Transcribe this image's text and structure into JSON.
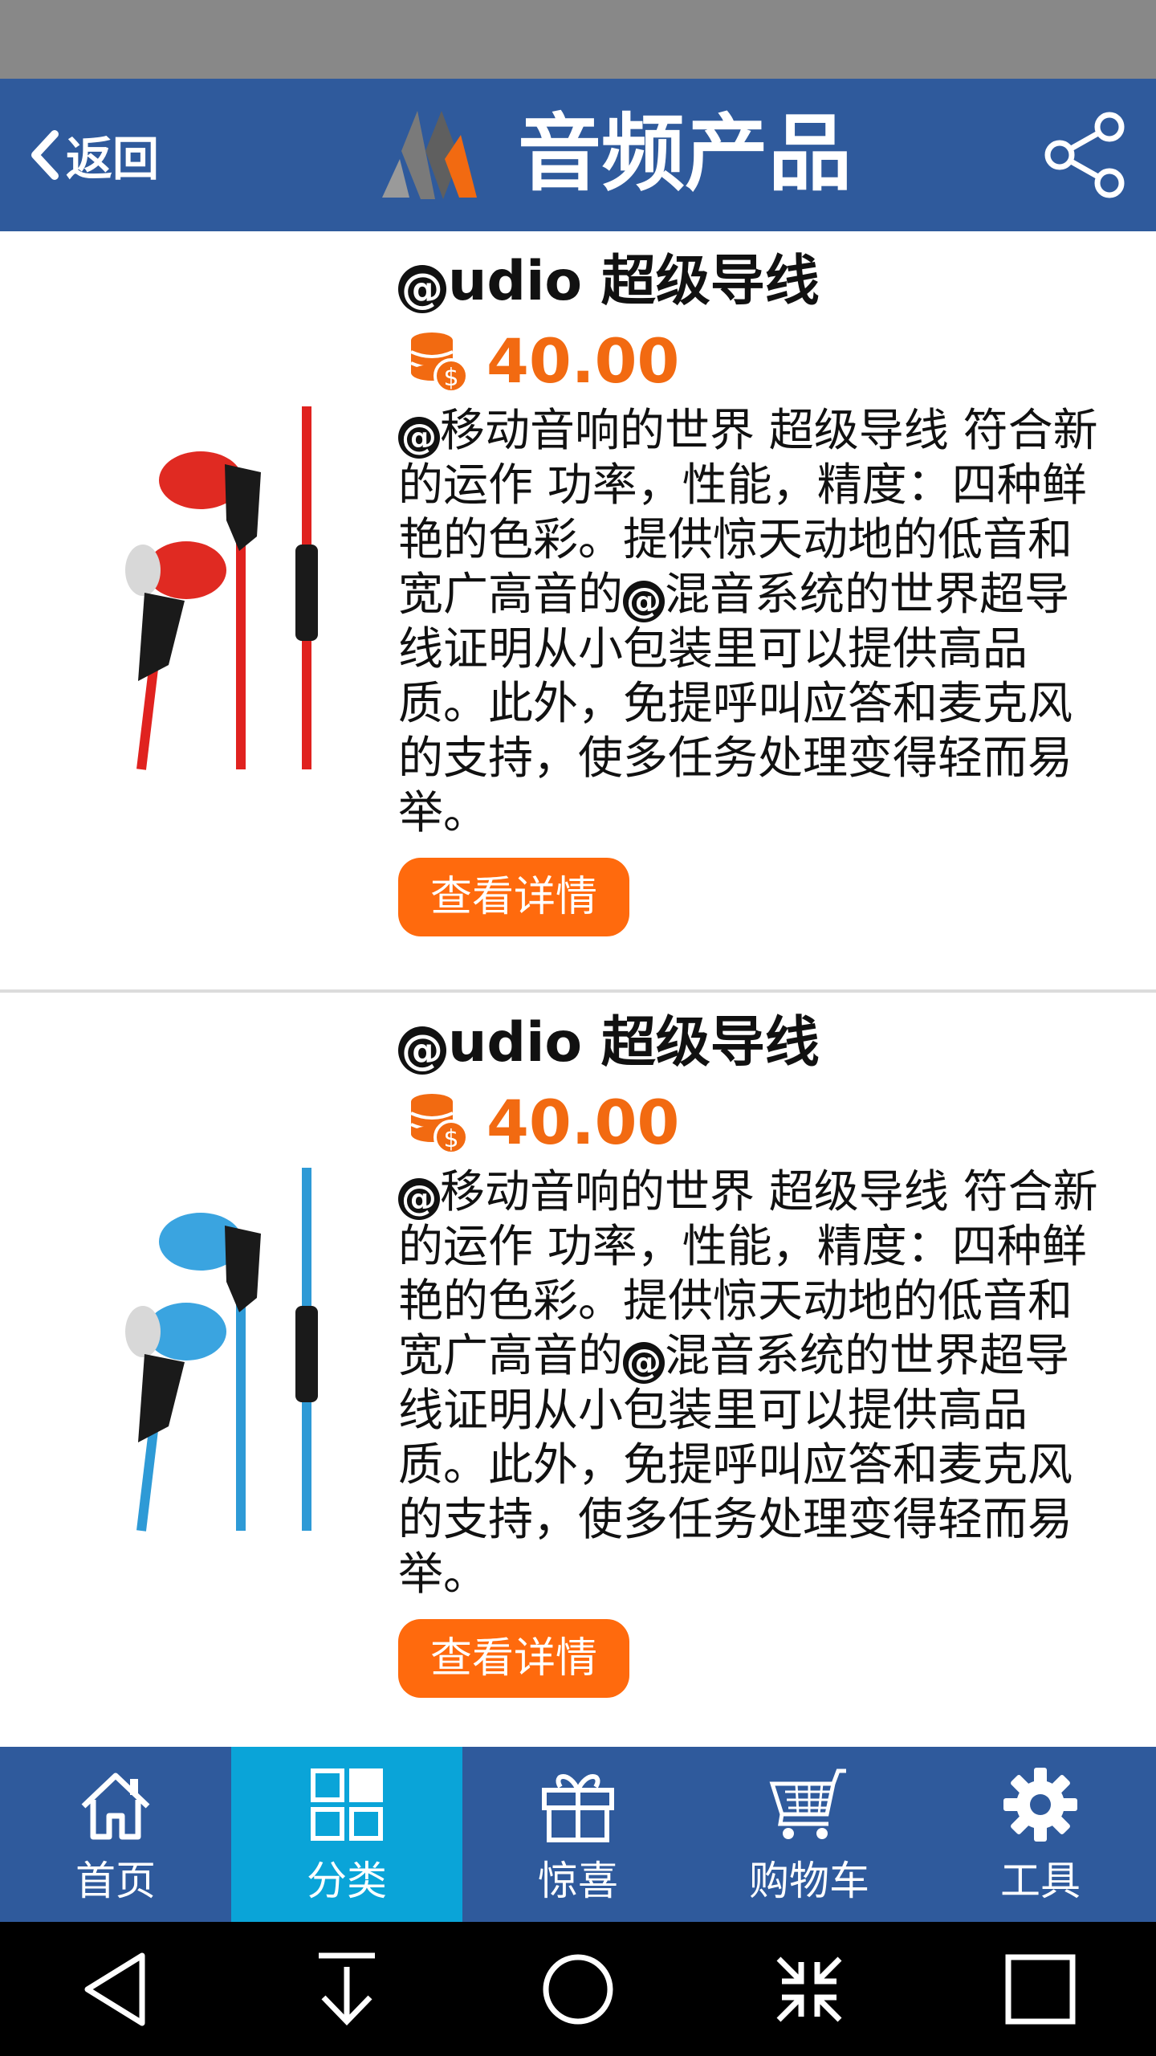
{
  "header": {
    "back_label": "返回",
    "title": "音频产品"
  },
  "products": [
    {
      "name_suffix": "udio 超级导线",
      "price": "40.00",
      "desc_part1": "移动音响的世界 超级导线 符合新的运作 功率，性能，精度：四种鲜艳的色彩。提供惊天动地的低音和宽广高音的",
      "desc_part2": "混音系统的世界超导线证明从小包装里可以提供高品质。此外，免提呼叫应答和麦克风的支持，使多任务处理变得轻而易举。",
      "details_label": "查看详情",
      "color": "red"
    },
    {
      "name_suffix": "udio 超级导线",
      "price": "40.00",
      "desc_part1": "移动音响的世界 超级导线 符合新的运作 功率，性能，精度：四种鲜艳的色彩。提供惊天动地的低音和宽广高音的",
      "desc_part2": "混音系统的世界超导线证明从小包装里可以提供高品质。此外，免提呼叫应答和麦克风的支持，使多任务处理变得轻而易举。",
      "details_label": "查看详情",
      "color": "blue"
    }
  ],
  "at_symbol": "@",
  "tabs": [
    {
      "label": "首页",
      "icon": "home-icon"
    },
    {
      "label": "分类",
      "icon": "category-icon",
      "active": true
    },
    {
      "label": "惊喜",
      "icon": "gift-icon"
    },
    {
      "label": "购物车",
      "icon": "cart-icon"
    },
    {
      "label": "工具",
      "icon": "gear-icon"
    }
  ],
  "colors": {
    "header": "#2f5a9c",
    "active_tab": "#0aa4d8",
    "price": "#f26a11",
    "button": "#ff6a0d",
    "product_1": "#e0221f",
    "product_2": "#2e9ad6"
  }
}
